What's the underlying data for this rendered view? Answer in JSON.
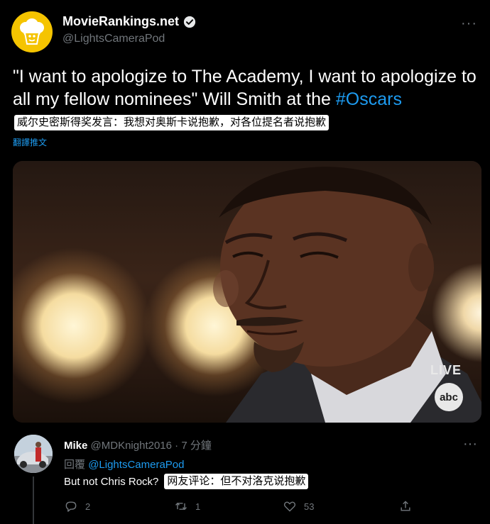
{
  "tweet": {
    "author_name": "MovieRankings.net",
    "author_handle": "@LightsCameraPod",
    "more_glyph": "···",
    "text_part1": "\"I want to apologize to The Academy, I want to apologize to all my fellow nominees\" Will Smith at the ",
    "hashtag": "#Oscars",
    "cn_caption": "威尔史密斯得奖发言：我想对奥斯卡说抱歉，对各位提名者说抱歉",
    "translate_label": "翻譯推文",
    "media": {
      "live_label": "LIVE",
      "network_logo": "abc"
    }
  },
  "reply": {
    "author_name": "Mike",
    "author_handle": "@MDKnight2016",
    "separator": "·",
    "time": "7 分鐘",
    "more_glyph": "···",
    "replying_prefix": "回覆",
    "replying_to": "@LightsCameraPod",
    "text": "But not Chris Rock?",
    "cn_caption": "网友评论：但不对洛克说抱歉",
    "actions": {
      "reply_count": "2",
      "retweet_count": "1",
      "like_count": "53"
    }
  },
  "colors": {
    "background": "#000000",
    "accent_blue": "#1d9bf0",
    "muted_gray": "#71767b",
    "avatar_yellow": "#f5c400"
  },
  "icons": [
    "popcorn-icon",
    "verified-badge-icon",
    "more-icon",
    "reply-icon",
    "retweet-icon",
    "like-icon",
    "share-icon"
  ]
}
